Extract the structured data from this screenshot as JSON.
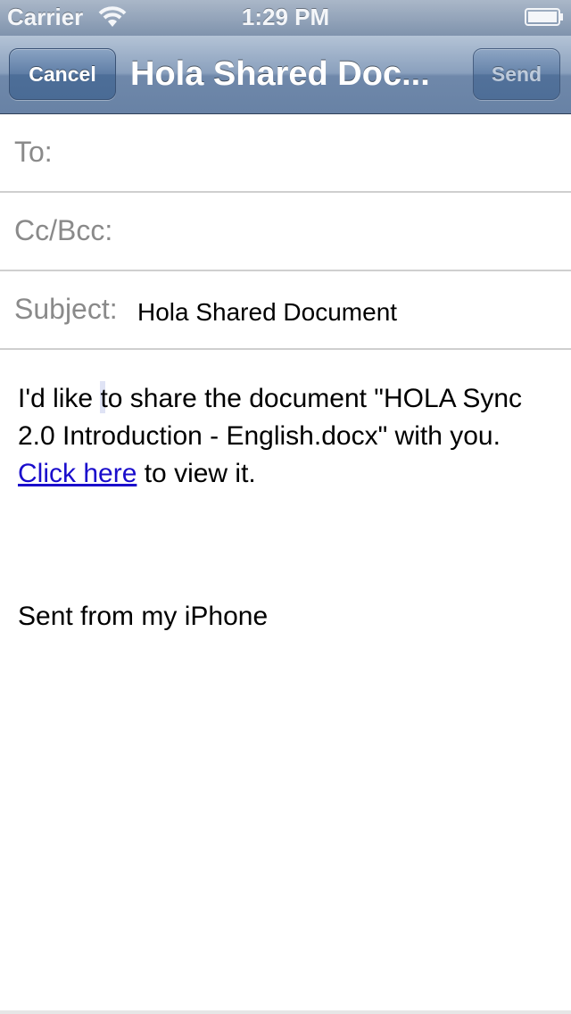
{
  "status_bar": {
    "carrier": "Carrier",
    "time": "1:29 PM",
    "wifi_icon": "wifi-icon",
    "battery_icon": "battery-icon"
  },
  "nav": {
    "cancel_label": "Cancel",
    "title": "Hola Shared Doc...",
    "send_label": "Send",
    "send_enabled": false
  },
  "fields": {
    "to_label": "To:",
    "to_value": "",
    "cc_label": "Cc/Bcc:",
    "cc_value": "",
    "subject_label": "Subject:",
    "subject_value": "Hola Shared Document"
  },
  "body": {
    "text_before_cursor": "I'd like ",
    "text_after_cursor": "to share the document \"HOLA Sync 2.0 Introduction - English.docx\" with you. ",
    "link_text": "Click here",
    "text_after_link": " to view it.",
    "signature": "Sent from my iPhone"
  },
  "colors": {
    "nav_bar": "#7f93ad",
    "link": "#1a0dcc",
    "label_gray": "#8a8a8a"
  }
}
